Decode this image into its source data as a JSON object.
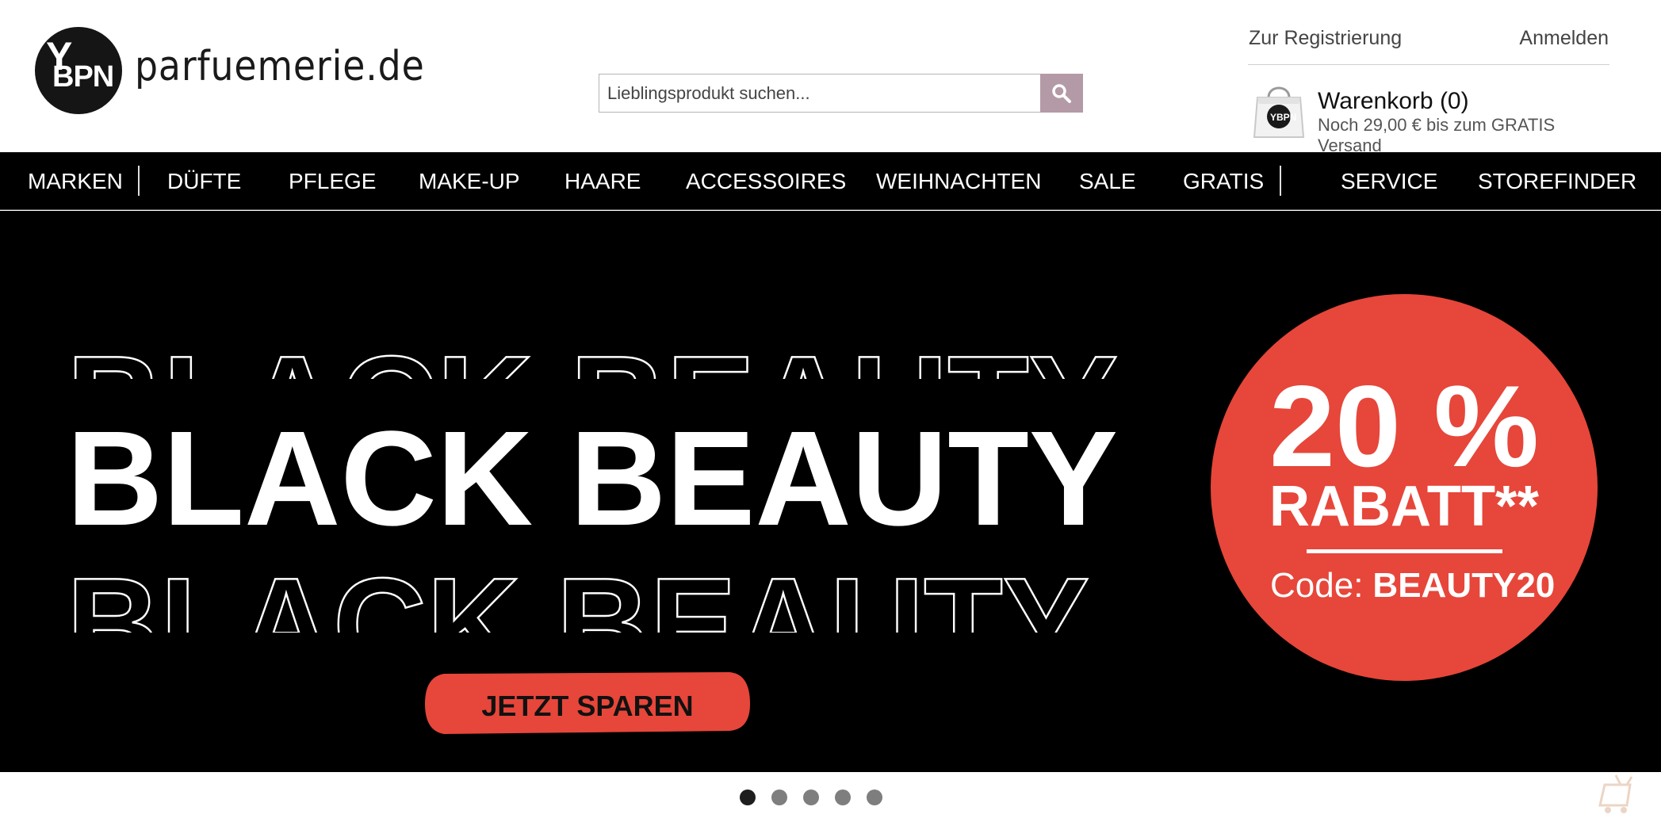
{
  "brand": {
    "logo_mark": "YBPN",
    "name": "parfuemerie.de"
  },
  "search": {
    "placeholder": "Lieblingsprodukt suchen...",
    "icon": "search-icon"
  },
  "account": {
    "register_label": "Zur Registrierung",
    "login_label": "Anmelden"
  },
  "cart": {
    "title": "Warenkorb (0)",
    "shipping_note": "Noch 29,00 € bis zum GRATIS Versand",
    "icon": "shopping-bag-icon"
  },
  "nav": {
    "items": [
      "MARKEN",
      "DÜFTE",
      "PFLEGE",
      "MAKE-UP",
      "HAARE",
      "ACCESSOIRES",
      "WEIHNACHTEN",
      "SALE",
      "GRATIS",
      "SERVICE",
      "STOREFINDER"
    ]
  },
  "hero": {
    "headline": "BLACK BEAUTY",
    "discount": "20 %",
    "discount_label": "RABATT**",
    "code_prefix": "Code:",
    "code": "BEAUTY20",
    "cta_label": "JETZT SPAREN"
  },
  "carousel": {
    "slide_count": 5,
    "active_index": 0
  },
  "colors": {
    "search_button": "#b49aa6",
    "promo_red": "#e7463a",
    "nav_bg": "#000000"
  }
}
